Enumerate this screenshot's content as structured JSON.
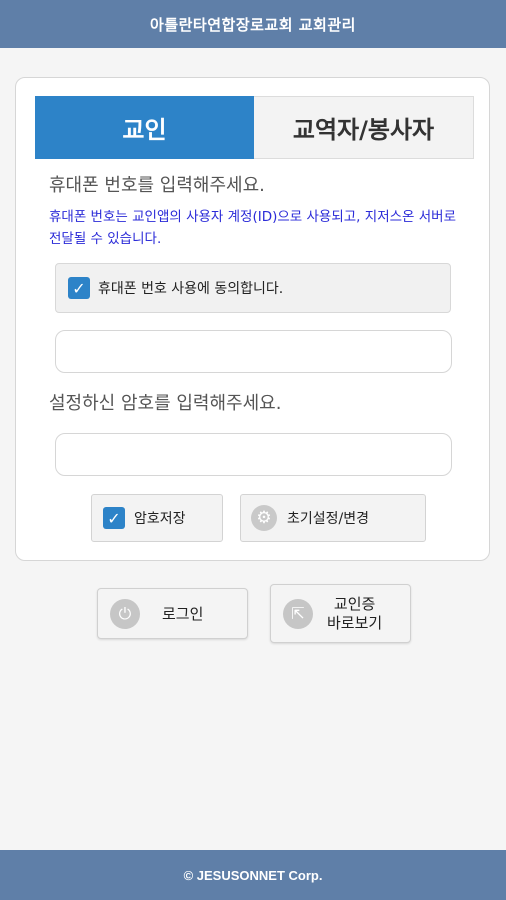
{
  "header": {
    "title": "아틀란타연합장로교회 교회관리"
  },
  "tabs": [
    {
      "label": "교인",
      "active": true
    },
    {
      "label": "교역자/봉사자",
      "active": false
    }
  ],
  "form": {
    "phone_label": "휴대폰 번호를 입력해주세요.",
    "notice": "휴대폰 번호는 교인앱의 사용자 계정(ID)으로 사용되고, 지저스온 서버로 전달될 수 있습니다.",
    "agree_label": "휴대폰 번호 사용에 동의합니다.",
    "agree_checked": true,
    "phone_value": "",
    "password_label": "설정하신 암호를 입력해주세요.",
    "password_value": "",
    "save_password_label": "암호저장",
    "save_password_checked": true,
    "reset_label": "초기설정/변경"
  },
  "actions": {
    "login_label": "로그인",
    "card_line1": "교인증",
    "card_line2": "바로보기"
  },
  "footer": {
    "text": "© JESUSONNET Corp."
  },
  "colors": {
    "bar": "#5f7fa8",
    "accent": "#2d83c8",
    "notice": "#2b2bd8"
  }
}
